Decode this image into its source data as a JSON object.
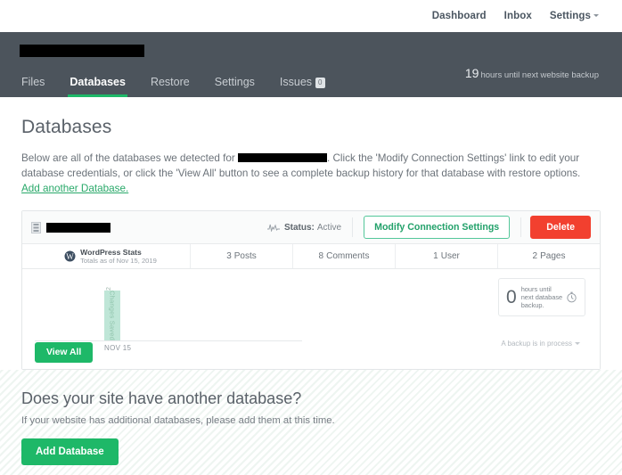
{
  "topnav": {
    "items": [
      {
        "label": "Dashboard"
      },
      {
        "label": "Inbox"
      },
      {
        "label": "Settings"
      }
    ]
  },
  "apphead": {
    "site_name_redacted": "",
    "backup_hours": "19",
    "backup_note": "hours until next website backup",
    "tabs": [
      {
        "label": "Files",
        "active": false
      },
      {
        "label": "Databases",
        "active": true
      },
      {
        "label": "Restore",
        "active": false
      },
      {
        "label": "Settings",
        "active": false
      },
      {
        "label": "Issues",
        "active": false,
        "badge": "0"
      }
    ]
  },
  "main": {
    "page_title": "Databases",
    "intro_part1": "Below are all of the databases we detected for",
    "intro_part2": ". Click the 'Modify Connection Settings' link to edit your database credentials, or click the 'View All' button to see a complete backup history for that database with restore options.",
    "intro_link": "Add another Database."
  },
  "database_card": {
    "name_redacted": "",
    "status_label": "Status:",
    "status_value": "Active",
    "modify_button": "Modify Connection Settings",
    "delete_button": "Delete",
    "stats": {
      "title": "WordPress Stats",
      "subtitle": "Totals as of Nov 15, 2019",
      "cells": [
        {
          "num": "3",
          "label": "Posts"
        },
        {
          "num": "8",
          "label": "Comments"
        },
        {
          "num": "1",
          "label": "User"
        },
        {
          "num": "2",
          "label": "Pages"
        }
      ]
    },
    "view_all_button": "View All",
    "timer_number": "0",
    "timer_text": "hours until next database backup.",
    "process_note": "A backup is in process"
  },
  "chart_data": {
    "type": "bar",
    "title": "",
    "categories": [
      "NOV 15"
    ],
    "values": [
      12
    ],
    "bar_label": "Changes Saved",
    "value_label": "12",
    "xlabel": "",
    "ylabel": "Changes Saved",
    "ylim": [
      0,
      13
    ],
    "grid": false,
    "legend": "none",
    "bar_color": "#bfe6d7"
  },
  "promo": {
    "title": "Does your site have another database?",
    "subtitle": "If your website has additional databases, please add them at this time.",
    "button": "Add Database"
  },
  "colors": {
    "header_bg": "#4c545c",
    "accent_green": "#1eb868",
    "danger_red": "#f2402f",
    "link_green": "#29a96a",
    "bar_green": "#bfe6d7"
  }
}
